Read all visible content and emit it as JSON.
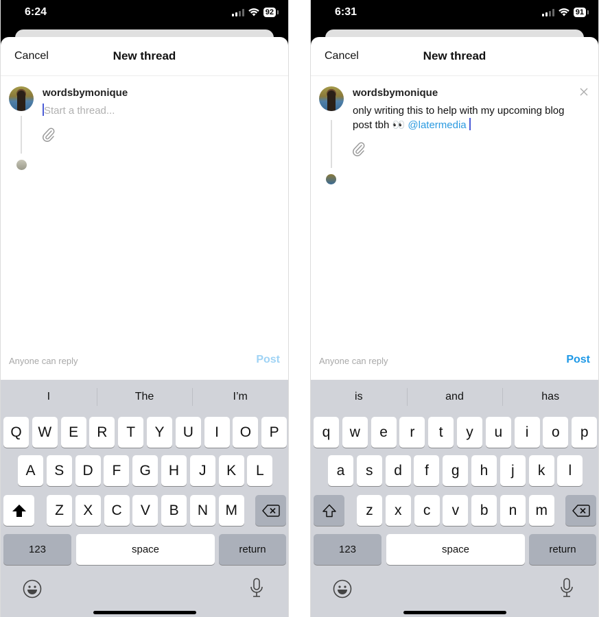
{
  "screens": [
    {
      "status": {
        "time": "6:24",
        "battery": "92"
      },
      "nav": {
        "cancel": "Cancel",
        "title": "New thread"
      },
      "composer": {
        "username": "wordsbymonique",
        "placeholder": "Start a thread...",
        "text": "",
        "mention": ""
      },
      "footer": {
        "reply_setting": "Anyone can reply",
        "post": "Post",
        "post_enabled": false
      },
      "keyboard": {
        "suggestions": [
          "I",
          "The",
          "I’m"
        ],
        "row1": [
          "Q",
          "W",
          "E",
          "R",
          "T",
          "Y",
          "U",
          "I",
          "O",
          "P"
        ],
        "row2": [
          "A",
          "S",
          "D",
          "F",
          "G",
          "H",
          "J",
          "K",
          "L"
        ],
        "row3": [
          "Z",
          "X",
          "C",
          "V",
          "B",
          "N",
          "M"
        ],
        "shift_active": true,
        "numbers": "123",
        "space": "space",
        "return": "return"
      }
    },
    {
      "status": {
        "time": "6:31",
        "battery": "91"
      },
      "nav": {
        "cancel": "Cancel",
        "title": "New thread"
      },
      "composer": {
        "username": "wordsbymonique",
        "placeholder": "",
        "text": "only writing this to help with my upcoming blog post tbh 👀 ",
        "mention": "@latermedia"
      },
      "footer": {
        "reply_setting": "Anyone can reply",
        "post": "Post",
        "post_enabled": true
      },
      "keyboard": {
        "suggestions": [
          "is",
          "and",
          "has"
        ],
        "row1": [
          "q",
          "w",
          "e",
          "r",
          "t",
          "y",
          "u",
          "i",
          "o",
          "p"
        ],
        "row2": [
          "a",
          "s",
          "d",
          "f",
          "g",
          "h",
          "j",
          "k",
          "l"
        ],
        "row3": [
          "z",
          "x",
          "c",
          "v",
          "b",
          "n",
          "m"
        ],
        "shift_active": false,
        "numbers": "123",
        "space": "space",
        "return": "return"
      }
    }
  ]
}
